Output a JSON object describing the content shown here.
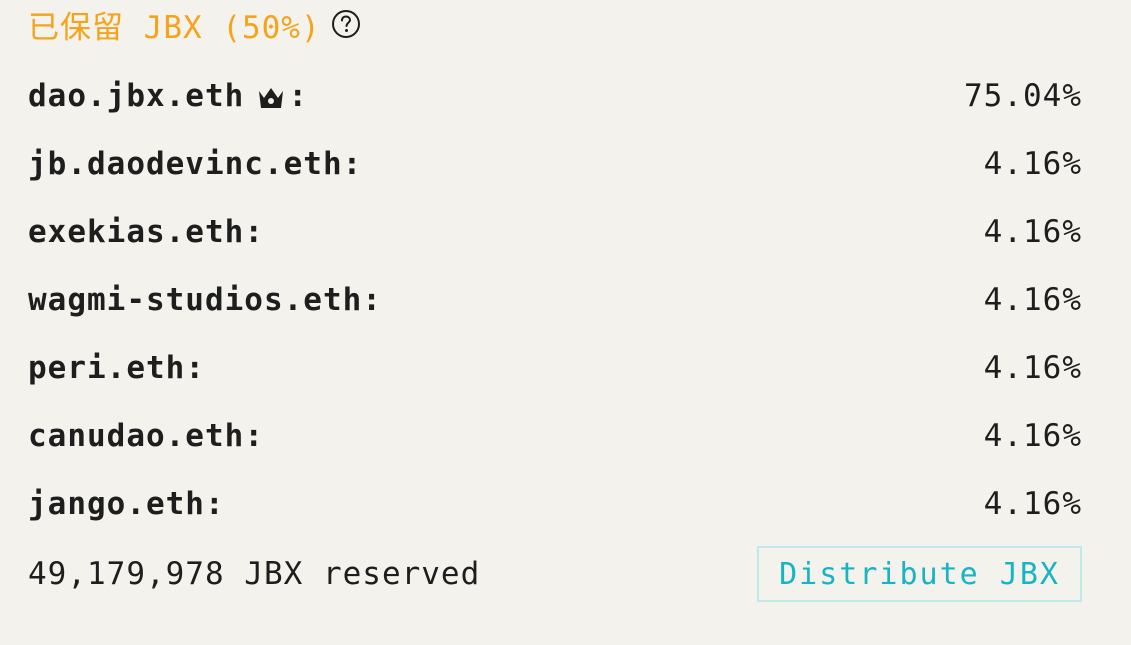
{
  "header": {
    "title": "已保留 JBX (50%)",
    "help_icon": "question-circle-icon"
  },
  "splits": [
    {
      "name": "dao.jbx.eth",
      "owner_icon": "crown-icon",
      "percent": "75.04%"
    },
    {
      "name": "jb.daodevinc.eth",
      "percent": "4.16%"
    },
    {
      "name": "exekias.eth",
      "percent": "4.16%"
    },
    {
      "name": "wagmi-studios.eth",
      "percent": "4.16%"
    },
    {
      "name": "peri.eth",
      "percent": "4.16%"
    },
    {
      "name": "canudao.eth",
      "percent": "4.16%"
    },
    {
      "name": "jango.eth",
      "percent": "4.16%"
    }
  ],
  "footer": {
    "reserved_text": "49,179,978 JBX reserved",
    "distribute_label": "Distribute JBX"
  },
  "colors": {
    "title": "#f5a31a",
    "accent": "#19b4c4",
    "button_border": "#bfe9ea",
    "background": "#f4f2ec",
    "text": "#1e1e1e"
  }
}
